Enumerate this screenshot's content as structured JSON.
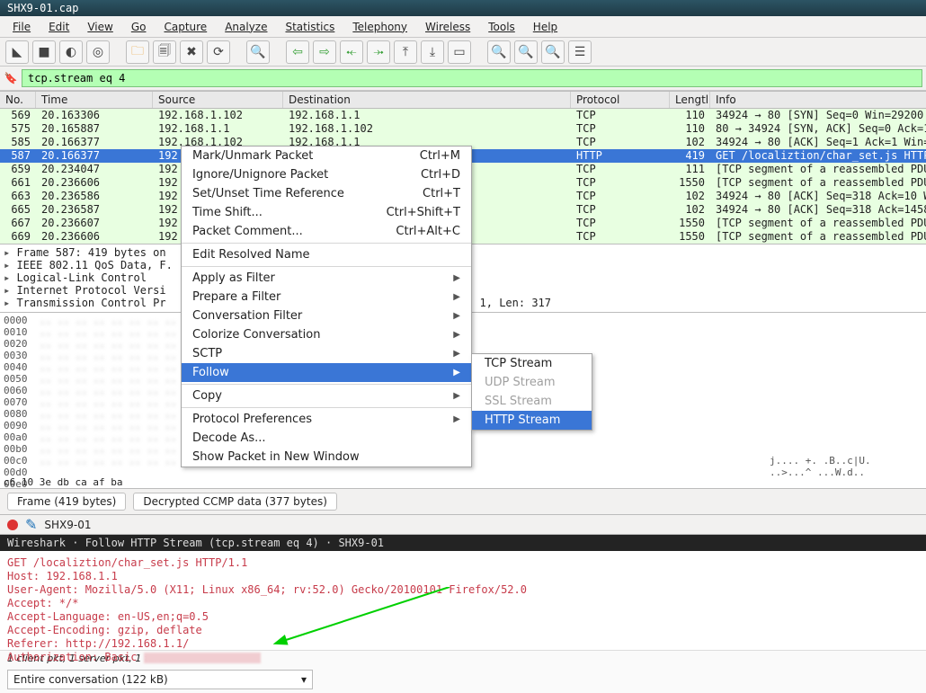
{
  "title": "SHX9-01.cap",
  "menu": [
    "File",
    "Edit",
    "View",
    "Go",
    "Capture",
    "Analyze",
    "Statistics",
    "Telephony",
    "Wireless",
    "Tools",
    "Help"
  ],
  "filter": "tcp.stream eq 4",
  "columns": {
    "no": "No.",
    "time": "Time",
    "src": "Source",
    "dst": "Destination",
    "proto": "Protocol",
    "len": "Lengtl",
    "info": "Info"
  },
  "packets": [
    {
      "no": "569",
      "time": "20.163306",
      "src": "192.168.1.102",
      "dst": "192.168.1.1",
      "proto": "TCP",
      "len": "110",
      "info": "34924 → 80 [SYN] Seq=0 Win=29200 Le"
    },
    {
      "no": "575",
      "time": "20.165887",
      "src": "192.168.1.1",
      "dst": "192.168.1.102",
      "proto": "TCP",
      "len": "110",
      "info": "80 → 34924 [SYN, ACK] Seq=0 Ack=1 W"
    },
    {
      "no": "585",
      "time": "20.166377",
      "src": "192.168.1.102",
      "dst": "192.168.1.1",
      "proto": "TCP",
      "len": "102",
      "info": "34924 → 80 [ACK] Seq=1 Ack=1 Win=29"
    },
    {
      "no": "587",
      "time": "20.166377",
      "src": "192",
      "dst": "",
      "proto": "HTTP",
      "len": "419",
      "info": "GET /localiztion/char_set.js HTTP/1",
      "sel": true
    },
    {
      "no": "659",
      "time": "20.234047",
      "src": "192",
      "dst": "",
      "proto": "TCP",
      "len": "111",
      "info": "[TCP segment of a reassembled PDU]"
    },
    {
      "no": "661",
      "time": "20.236606",
      "src": "192",
      "dst": "",
      "proto": "TCP",
      "len": "1550",
      "info": "[TCP segment of a reassembled PDU]"
    },
    {
      "no": "663",
      "time": "20.236586",
      "src": "192",
      "dst": "",
      "proto": "TCP",
      "len": "102",
      "info": "34924 → 80 [ACK] Seq=318 Ack=10 Win"
    },
    {
      "no": "665",
      "time": "20.236587",
      "src": "192",
      "dst": "",
      "proto": "TCP",
      "len": "102",
      "info": "34924 → 80 [ACK] Seq=318 Ack=1458 W"
    },
    {
      "no": "667",
      "time": "20.236607",
      "src": "192",
      "dst": "",
      "proto": "TCP",
      "len": "1550",
      "info": "[TCP segment of a reassembled PDU]"
    },
    {
      "no": "669",
      "time": "20.236606",
      "src": "192",
      "dst": "",
      "proto": "TCP",
      "len": "1550",
      "info": "[TCP segment of a reassembled PDU]"
    }
  ],
  "tree": [
    "Frame 587: 419 bytes on",
    "IEEE 802.11 QoS Data, F.",
    "Logical-Link Control",
    "Internet Protocol Versi",
    "Transmission Control Pr"
  ],
  "tree_suffix": "ck: 1, Len: 317",
  "hex_offsets": [
    "0000",
    "0010",
    "0020",
    "0030",
    "0040",
    "0050",
    "0060",
    "0070",
    "0080",
    "0090",
    "00a0",
    "00b0",
    "00c0",
    "00d0",
    "00e0"
  ],
  "hex_ascii_sample": [
    "j.... +. .B..c|U.",
    "..>...^ ...W.d.."
  ],
  "hex_last_line": "c6 10 3e db ca af ba",
  "tabs": [
    "Frame (419 bytes)",
    "Decrypted CCMP data (377 bytes)"
  ],
  "status_file": "SHX9-01",
  "dialog_title": "Wireshark · Follow HTTP Stream (tcp.stream eq 4) · SHX9-01",
  "http": [
    "GET /localiztion/char_set.js HTTP/1.1",
    "Host: 192.168.1.1",
    "User-Agent: Mozilla/5.0 (X11; Linux x86_64; rv:52.0) Gecko/20100101 Firefox/52.0",
    "Accept: */*",
    "Accept-Language: en-US,en;q=0.5",
    "Accept-Encoding: gzip, deflate",
    "Referer: http://192.168.1.1/",
    "Authorization: Basic "
  ],
  "client_line": "1 client pkt, 1 server pkt, 1 turn.",
  "conv_select": "Entire conversation (122 kB)",
  "ctx": {
    "mark": "Mark/Unmark Packet",
    "mark_k": "Ctrl+M",
    "ignore": "Ignore/Unignore Packet",
    "ignore_k": "Ctrl+D",
    "timeref": "Set/Unset Time Reference",
    "timeref_k": "Ctrl+T",
    "shift": "Time Shift...",
    "shift_k": "Ctrl+Shift+T",
    "comment": "Packet Comment...",
    "comment_k": "Ctrl+Alt+C",
    "resolved": "Edit Resolved Name",
    "applyf": "Apply as Filter",
    "prepf": "Prepare a Filter",
    "convf": "Conversation Filter",
    "colorize": "Colorize Conversation",
    "sctp": "SCTP",
    "follow": "Follow",
    "copy": "Copy",
    "protopref": "Protocol Preferences",
    "decode": "Decode As...",
    "newwin": "Show Packet in New Window"
  },
  "submenu": {
    "tcp": "TCP Stream",
    "udp": "UDP Stream",
    "ssl": "SSL Stream",
    "http": "HTTP Stream"
  }
}
